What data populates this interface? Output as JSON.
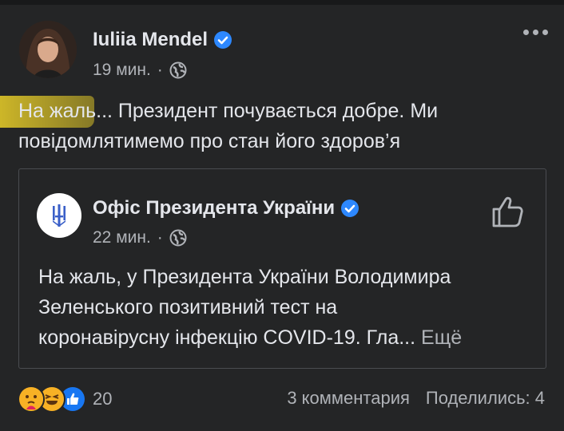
{
  "post": {
    "author": "Iuliia Mendel",
    "time": "19 мин.",
    "separator": "·",
    "text_lines": [
      "На жаль... Президент почувається добре. Ми",
      "повідомлятимемо про стан його здоров’я"
    ]
  },
  "shared": {
    "page_name": "Офіс Президента України",
    "time": "22 мин.",
    "separator": "·",
    "text_lines": [
      "На жаль, у Президента України Володимира",
      "Зеленського позитивний тест на",
      "коронавірусну інфекцію COVID-19. Гла..."
    ],
    "see_more": "Ещё"
  },
  "footer": {
    "reaction_icons": [
      "care",
      "haha",
      "like"
    ],
    "reaction_count": "20",
    "comments": "3 комментария",
    "shares": "Поделились: 4"
  },
  "colors": {
    "background": "#242526",
    "text": "#e4e6eb",
    "secondary_text": "#b0b3b8",
    "verified_blue": "#2d88ff",
    "highlight": "#d6be28"
  }
}
